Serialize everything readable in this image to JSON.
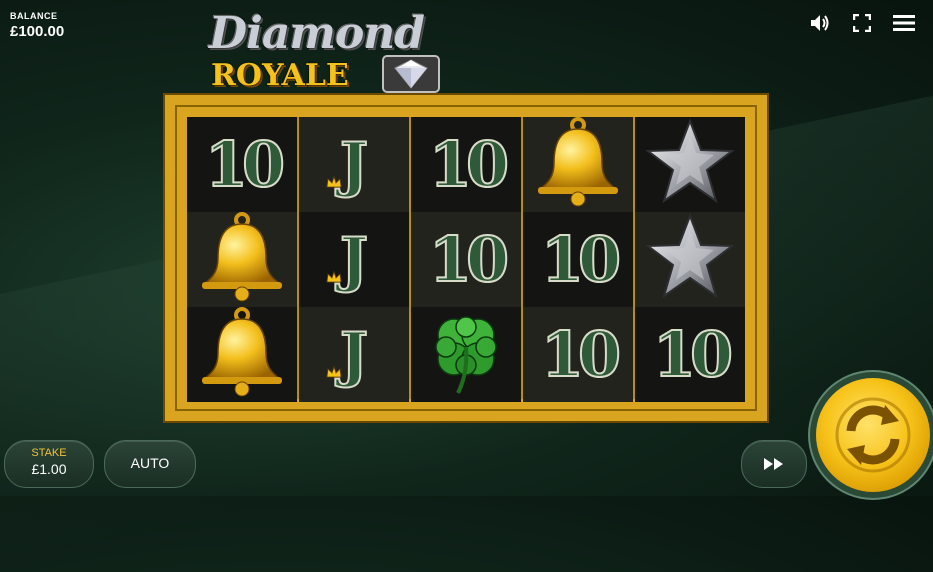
{
  "balance": {
    "label": "BALANCE",
    "value": "£100.00"
  },
  "logo": {
    "line1": "Diamond",
    "line2": "ROYALE"
  },
  "top_icons": [
    "speaker-icon",
    "fullscreen-icon",
    "menu-icon"
  ],
  "reels": [
    [
      "10",
      "bell",
      "bell"
    ],
    [
      "J",
      "J",
      "J"
    ],
    [
      "10",
      "10",
      "clover"
    ],
    [
      "bell",
      "10",
      "10"
    ],
    [
      "star",
      "star",
      "10"
    ]
  ],
  "controls": {
    "stake_label": "STAKE",
    "stake_value": "£1.00",
    "auto_label": "AUTO"
  },
  "colors": {
    "gold": "#d9a521",
    "accent": "#f7c31a",
    "felt": "#10261b"
  }
}
